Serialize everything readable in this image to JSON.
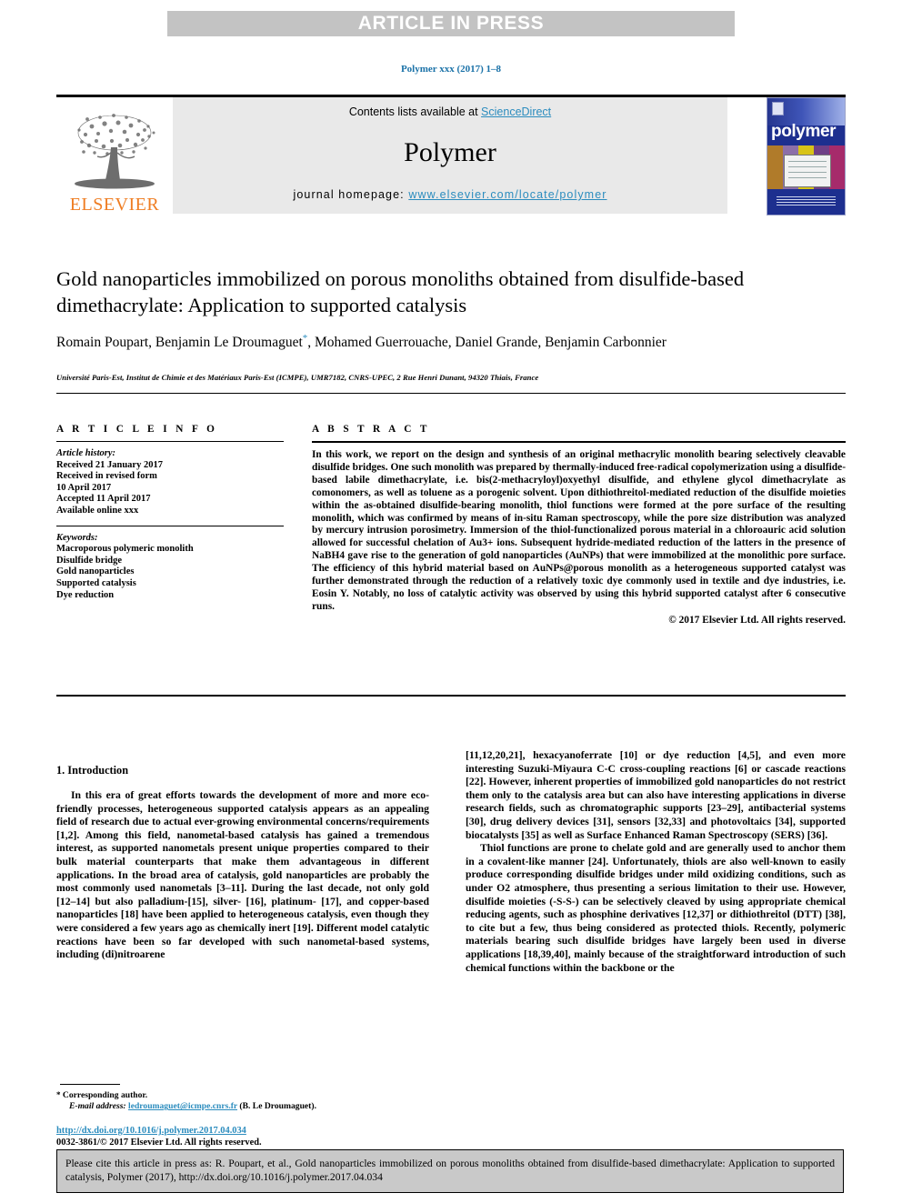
{
  "banner": {
    "text": "ARTICLE IN PRESS"
  },
  "running_head": {
    "text": "Polymer xxx (2017) 1–8"
  },
  "masthead": {
    "publisher_name": "ELSEVIER",
    "contents_prefix": "Contents lists available at ",
    "contents_link": "ScienceDirect",
    "journal_name": "Polymer",
    "homepage_prefix": "journal homepage: ",
    "homepage_url": "www.elsevier.com/locate/polymer",
    "cover_title": "polymer"
  },
  "article": {
    "title": "Gold nanoparticles immobilized on porous monoliths obtained from disulfide-based dimethacrylate: Application to supported catalysis",
    "authors_before_star": "Romain Poupart, Benjamin Le Droumaguet",
    "corresponding_marker": "*",
    "authors_after_star": ", Mohamed Guerrouache, Daniel Grande, Benjamin Carbonnier",
    "affiliation": "Université Paris-Est, Institut de Chimie et des Matériaux Paris-Est (ICMPE), UMR7182, CNRS-UPEC, 2 Rue Henri Dunant, 94320 Thiais, France"
  },
  "info": {
    "heading": "A R T I C L E   I N F O",
    "history_title": "Article history:",
    "history_lines": [
      "Received 21 January 2017",
      "Received in revised form",
      "10 April 2017",
      "Accepted 11 April 2017",
      "Available online xxx"
    ],
    "keywords_title": "Keywords:",
    "keywords": [
      "Macroporous polymeric monolith",
      "Disulfide bridge",
      "Gold nanoparticles",
      "Supported catalysis",
      "Dye reduction"
    ]
  },
  "abstract": {
    "heading": "A B S T R A C T",
    "body": "In this work, we report on the design and synthesis of an original methacrylic monolith bearing selectively cleavable disulfide bridges. One such monolith was prepared by thermally-induced free-radical copolymerization using a disulfide-based labile dimethacrylate, i.e. bis(2-methacryloyl)oxyethyl disulfide, and ethylene glycol dimethacrylate as comonomers, as well as toluene as a porogenic solvent. Upon dithiothreitol-mediated reduction of the disulfide moieties within the as-obtained disulfide-bearing monolith, thiol functions were formed at the pore surface of the resulting monolith, which was confirmed by means of in-situ Raman spectroscopy, while the pore size distribution was analyzed by mercury intrusion porosimetry. Immersion of the thiol-functionalized porous material in a chloroauric acid solution allowed for successful chelation of Au3+ ions. Subsequent hydride-mediated reduction of the latters in the presence of NaBH4 gave rise to the generation of gold nanoparticles (AuNPs) that were immobilized at the monolithic pore surface. The efficiency of this hybrid material based on AuNPs@porous monolith as a heterogeneous supported catalyst was further demonstrated through the reduction of a relatively toxic dye commonly used in textile and dye industries, i.e. Eosin Y. Notably, no loss of catalytic activity was observed by using this hybrid supported catalyst after 6 consecutive runs.",
    "copyright": "© 2017 Elsevier Ltd. All rights reserved."
  },
  "intro": {
    "heading": "1.  Introduction",
    "left_paragraph_1": "In this era of great efforts towards the development of more and more eco-friendly processes, heterogeneous supported catalysis appears as an appealing field of research due to actual ever-growing environmental concerns/requirements [1,2]. Among this field, nanometal-based catalysis has gained a tremendous interest, as supported nanometals present unique properties compared to their bulk material counterparts that make them advantageous in different applications. In the broad area of catalysis, gold nanoparticles are probably the most commonly used nanometals [3–11]. During the last decade, not only gold [12–14] but also palladium-[15], silver- [16], platinum- [17], and copper-based nanoparticles [18] have been applied to heterogeneous catalysis, even though they were considered a few years ago as chemically inert [19]. Different model catalytic reactions have been so far developed with such nanometal-based systems, including (di)nitroarene",
    "right_paragraph_1": "[11,12,20,21], hexacyanoferrate [10] or dye reduction [4,5], and even more interesting Suzuki-Miyaura C-C cross-coupling reactions [6] or cascade reactions [22]. However, inherent properties of immobilized gold nanoparticles do not restrict them only to the catalysis area but can also have interesting applications in diverse research fields, such as chromatographic supports [23–29], antibacterial systems [30], drug delivery devices [31], sensors [32,33] and photovoltaics [34], supported biocatalysts [35] as well as Surface Enhanced Raman Spectroscopy (SERS) [36].",
    "right_paragraph_2": "Thiol functions are prone to chelate gold and are generally used to anchor them in a covalent-like manner [24]. Unfortunately, thiols are also well-known to easily produce corresponding disulfide bridges under mild oxidizing conditions, such as under O2 atmosphere, thus presenting a serious limitation to their use. However, disulfide moieties (-S-S-) can be selectively cleaved by using appropriate chemical reducing agents, such as phosphine derivatives [12,37] or dithiothreitol (DTT) [38], to cite but a few, thus being considered as protected thiols. Recently, polymeric materials bearing such disulfide bridges have largely been used in diverse applications [18,39,40], mainly because of the straightforward introduction of such chemical functions within the backbone or the"
  },
  "footnote": {
    "corresponding_label": "Corresponding author.",
    "email_label": "E-mail address:",
    "email": "ledroumaguet@icmpe.cnrs.fr",
    "email_suffix": "(B. Le Droumaguet)."
  },
  "doi": {
    "url": "http://dx.doi.org/10.1016/j.polymer.2017.04.034"
  },
  "issn_line": {
    "text": "0032-3861/© 2017 Elsevier Ltd. All rights reserved."
  },
  "cite_box": {
    "text": "Please cite this article in press as: R. Poupart, et al., Gold nanoparticles immobilized on porous monoliths obtained from disulfide-based dimethacrylate: Application to supported catalysis, Polymer (2017), http://dx.doi.org/10.1016/j.polymer.2017.04.034"
  },
  "colors": {
    "link": "#2b8cbe",
    "reference": "#2b7bb9",
    "banner_bg": "#c3c3c3",
    "masthead_bg": "#e9e9e9",
    "cite_bg": "#c9c9c9",
    "elsevier_orange": "#ef7d22",
    "cover_blue": "#1d2f8f"
  }
}
